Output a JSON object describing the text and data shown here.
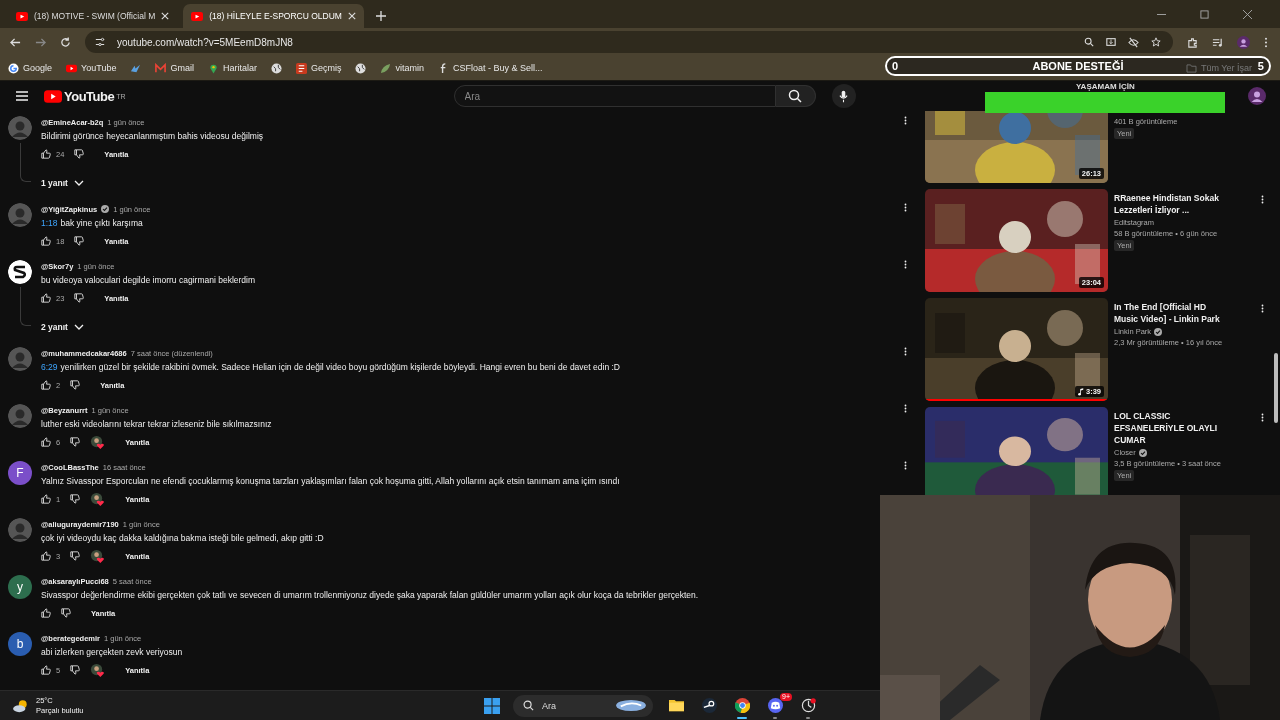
{
  "browser": {
    "tabs": [
      {
        "title": "(18) MOTIVE - SWIM (Official M",
        "selected": false
      },
      {
        "title": "(18) HİLEYLE E-SPORCU OLDUM",
        "selected": true
      }
    ],
    "address": "youtube.com/watch?v=5MEemD8mJN8",
    "bookmarks": [
      {
        "kind": "google",
        "label": "Google"
      },
      {
        "kind": "youtube",
        "label": "YouTube"
      },
      {
        "kind": "steam"
      },
      {
        "kind": "gmail",
        "label": "Gmail"
      },
      {
        "kind": "maps",
        "label": "Haritalar"
      },
      {
        "kind": "globe"
      },
      {
        "kind": "history",
        "label": "Geçmiş"
      },
      {
        "kind": "globe"
      },
      {
        "kind": "leaf",
        "label": "vitamin"
      },
      {
        "kind": "csfloat",
        "label": "CSFloat - Buy & Sell..."
      }
    ],
    "all_bookmarks": "Tüm Yer İşar"
  },
  "stream_overlay": {
    "goal": {
      "current": "0",
      "title": "ABONE DESTEĞİ",
      "target": "5",
      "level": 0
    },
    "banner_title": "YAŞAMAM İÇİN"
  },
  "masthead": {
    "logo": "YouTube",
    "region": "TR",
    "search_placeholder": "Ara"
  },
  "comments": [
    {
      "author": "@EmineAcar-b2q",
      "verified": false,
      "time": "1 gün önce",
      "text": "Bildirimi görünce heyecanlanmıştım bahis videosu değilmiş",
      "likes": "24",
      "hearted": false,
      "reply": "Yanıtla",
      "replies": "1 yanıt",
      "menu": true
    },
    {
      "author": "@YiğitZapkinus",
      "verified": true,
      "time": "1 gün önce",
      "link": "1:18",
      "text": "bak yine çıktı karşıma",
      "likes": "18",
      "hearted": false,
      "reply": "Yanıtla",
      "menu": true
    },
    {
      "avatar": {
        "kind": "logo"
      },
      "author": "@Skor7y",
      "verified": false,
      "time": "1 gün önce",
      "text": "bu videoya valoculari degilde imorru cagirmani beklerdim",
      "likes": "23",
      "hearted": false,
      "reply": "Yanıtla",
      "replies": "2 yanıt",
      "menu": true
    },
    {
      "author": "@muhammedcakar4686",
      "verified": false,
      "time": "7 saat önce (düzenlendi)",
      "link": "6:29",
      "text": "yenilirken güzel bir şekilde rakibini övmek. Sadece Helian için de değil video boyu gördüğüm kişilerde böyleydi. Hangi evren bu beni de davet edin :D",
      "likes": "2",
      "hearted": false,
      "reply": "Yanıtla",
      "menu": true
    },
    {
      "author": "@Beyzanurrt",
      "verified": false,
      "time": "1 gün önce",
      "text": "luther eski videolarını tekrar tekrar izleseniz bile sıkılmazsınız",
      "likes": "6",
      "hearted": true,
      "reply": "Yanıtla",
      "menu": true
    },
    {
      "avatar": {
        "kind": "letter",
        "letter": "F",
        "color": "#7b4fc9"
      },
      "author": "@CooLBassThe",
      "verified": false,
      "time": "16 saat önce",
      "text": "Yalnız Sivasspor Esporculan ne efendi çocuklarmış konuşma tarzları yaklaşımları falan çok hoşuma gitti, Allah yollarını açık etsin tanımam ama içim ısındı",
      "likes": "1",
      "hearted": true,
      "reply": "Yanıtla",
      "menu": true
    },
    {
      "author": "@aliuguraydemir7190",
      "verified": false,
      "time": "1 gün önce",
      "text": "çok iyi videoydu kaç dakka kaldığına bakma isteği bile gelmedi, akıp gitti :D",
      "likes": "3",
      "hearted": true,
      "reply": "Yanıtla",
      "menu": false
    },
    {
      "avatar": {
        "kind": "letter",
        "letter": "y",
        "color": "#2d6e4e"
      },
      "author": "@aksaraylıPucci68",
      "verified": false,
      "time": "5 saat önce",
      "text": "Sivasspor değerlendirme ekibi gerçekten çok tatlı ve sevecen di umarım trollenmiyoruz diyede şaka yaparak falan güldüler umarım yolları açık olur koça da tebrikler gerçekten.",
      "hearted": false,
      "reply": "Yanıtla",
      "menu": false
    },
    {
      "avatar": {
        "kind": "letter",
        "letter": "b",
        "color": "#2a5db0"
      },
      "author": "@berategedemir",
      "verified": false,
      "time": "1 gün önce",
      "text": "abi izlerken gerçekten zevk veriyosun",
      "likes": "5",
      "hearted": true,
      "reply": "Yanıtla",
      "menu": false
    }
  ],
  "related": [
    {
      "duration": "26:13",
      "music": false,
      "views": "401 B görüntüleme",
      "new_badge": "Yeni"
    },
    {
      "duration": "23:04",
      "music": false,
      "title": "RRaenee Hindistan Sokak Lezzetleri İzliyor ...",
      "channel": "Editstagram",
      "verified": false,
      "views": "58 B görüntüleme • 6 gün önce",
      "new_badge": "Yeni"
    },
    {
      "duration": "3:39",
      "music": true,
      "level": 1,
      "title": "In The End [Official HD Music Video] - Linkin Park",
      "channel": "Linkin Park",
      "verified": true,
      "views": "2,3 Mr görüntüleme • 16 yıl önce"
    },
    {
      "title": "LOL CLASSIC EFSANELERİYLE OLAYLI CUMAR",
      "channel": "Closer",
      "verified": true,
      "views": "3,5 B görüntüleme • 3 saat önce",
      "new_badge": "Yeni"
    }
  ],
  "taskbar": {
    "weather": {
      "temp": "25°C",
      "condition": "Parçalı bulutlu"
    },
    "search_placeholder": "Ara",
    "apps": [
      {
        "kind": "explorer",
        "running": false,
        "selected": false
      },
      {
        "kind": "steam",
        "running": false,
        "selected": false
      },
      {
        "kind": "chrome",
        "running": true,
        "selected": true
      },
      {
        "kind": "discord",
        "running": true,
        "selected": false,
        "badge": "9+"
      },
      {
        "kind": "app",
        "running": true,
        "selected": false
      }
    ]
  }
}
